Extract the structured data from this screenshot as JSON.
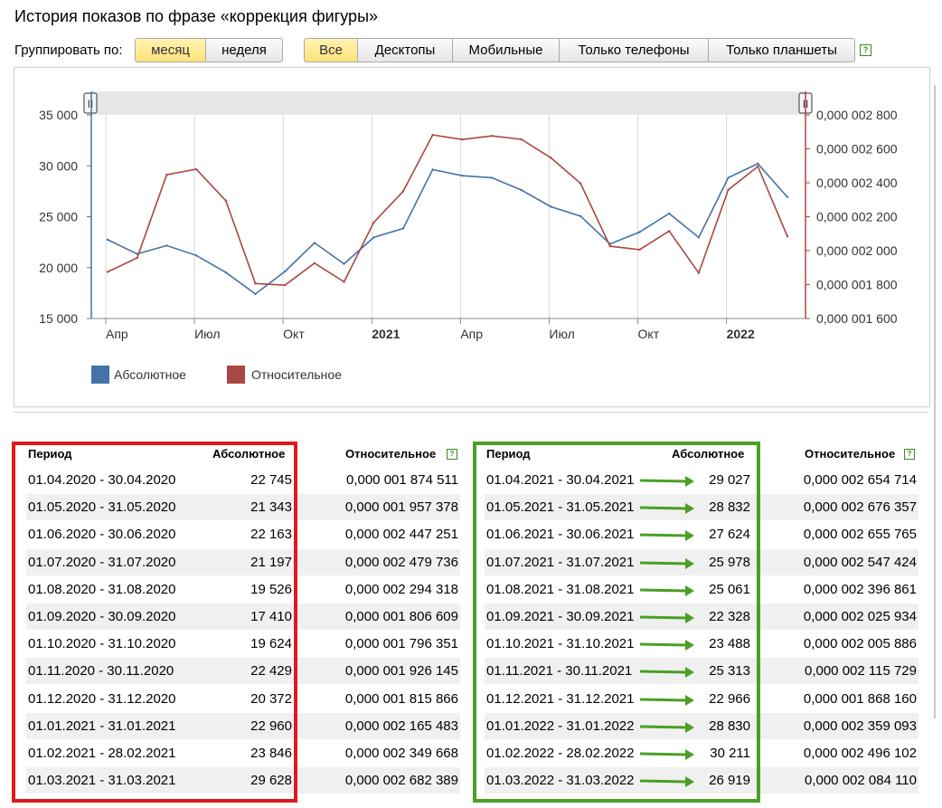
{
  "title": "История показов по фразе «коррекция фигуры»",
  "group_by": {
    "label": "Группировать по:",
    "options": [
      "месяц",
      "неделя"
    ],
    "active": "месяц"
  },
  "device_tabs": {
    "options": [
      "Все",
      "Десктопы",
      "Мобильные",
      "Только телефоны",
      "Только планшеты"
    ],
    "active": "Все"
  },
  "help_label": "?",
  "chart_data": {
    "type": "line",
    "x": [
      "2020-04",
      "2020-05",
      "2020-06",
      "2020-07",
      "2020-08",
      "2020-09",
      "2020-10",
      "2020-11",
      "2020-12",
      "2021-01",
      "2021-02",
      "2021-03",
      "2021-04",
      "2021-05",
      "2021-06",
      "2021-07",
      "2021-08",
      "2021-09",
      "2021-10",
      "2021-11",
      "2021-12",
      "2022-01",
      "2022-02",
      "2022-03"
    ],
    "x_tick_labels": [
      "Апр",
      "Июл",
      "Окт",
      "2021",
      "Апр",
      "Июл",
      "Окт",
      "2022"
    ],
    "x_tick_positions": [
      "2020-04",
      "2020-07",
      "2020-10",
      "2021-01",
      "2021-04",
      "2021-07",
      "2021-10",
      "2022-01"
    ],
    "bold_ticks": [
      "2021",
      "2022"
    ],
    "series": [
      {
        "name": "Абсолютное",
        "axis": "left",
        "color": "#4572a7",
        "values": [
          22745,
          21343,
          22163,
          21197,
          19526,
          17410,
          19624,
          22429,
          20372,
          22960,
          23846,
          29628,
          29027,
          28832,
          27624,
          25978,
          25061,
          22328,
          23488,
          25313,
          22966,
          28830,
          30211,
          26919
        ]
      },
      {
        "name": "Относительное",
        "axis": "right",
        "color": "#aa4643",
        "values": [
          1.874511e-06,
          1.957378e-06,
          2.447251e-06,
          2.479736e-06,
          2.294318e-06,
          1.806609e-06,
          1.796351e-06,
          1.926145e-06,
          1.815866e-06,
          2.165483e-06,
          2.349668e-06,
          2.682389e-06,
          2.654714e-06,
          2.676357e-06,
          2.655765e-06,
          2.547424e-06,
          2.396861e-06,
          2.025934e-06,
          2.005886e-06,
          2.115729e-06,
          1.86816e-06,
          2.359093e-06,
          2.496102e-06,
          2.08411e-06
        ]
      }
    ],
    "y_left": {
      "ylim": [
        15000,
        35000
      ],
      "tick_labels": [
        "35 000",
        "30 000",
        "25 000",
        "20 000",
        "15 000"
      ]
    },
    "y_right": {
      "ylim": [
        1.6e-06,
        2.8e-06
      ],
      "tick_labels": [
        "0,000 002 800",
        "0,000 002 600",
        "0,000 002 400",
        "0,000 002 200",
        "0,000 002 000",
        "0,000 001 800",
        "0,000 001 600"
      ]
    },
    "legend": [
      {
        "label": "Абсолютное",
        "color": "#4572a7"
      },
      {
        "label": "Относительное",
        "color": "#aa4643"
      }
    ],
    "navigator_handle_label": "II"
  },
  "table_left": {
    "headers": {
      "period": "Период",
      "abs": "Абсолютное",
      "rel": "Относительное"
    },
    "rows": [
      [
        "01.04.2020 - 30.04.2020",
        "22 745",
        "0,000 001 874 511"
      ],
      [
        "01.05.2020 - 31.05.2020",
        "21 343",
        "0,000 001 957 378"
      ],
      [
        "01.06.2020 - 30.06.2020",
        "22 163",
        "0,000 002 447 251"
      ],
      [
        "01.07.2020 - 31.07.2020",
        "21 197",
        "0,000 002 479 736"
      ],
      [
        "01.08.2020 - 31.08.2020",
        "19 526",
        "0,000 002 294 318"
      ],
      [
        "01.09.2020 - 30.09.2020",
        "17 410",
        "0,000 001 806 609"
      ],
      [
        "01.10.2020 - 31.10.2020",
        "19 624",
        "0,000 001 796 351"
      ],
      [
        "01.11.2020 - 30.11.2020",
        "22 429",
        "0,000 001 926 145"
      ],
      [
        "01.12.2020 - 31.12.2020",
        "20 372",
        "0,000 001 815 866"
      ],
      [
        "01.01.2021 - 31.01.2021",
        "22 960",
        "0,000 002 165 483"
      ],
      [
        "01.02.2021 - 28.02.2021",
        "23 846",
        "0,000 002 349 668"
      ],
      [
        "01.03.2021 - 31.03.2021",
        "29 628",
        "0,000 002 682 389"
      ]
    ]
  },
  "table_right": {
    "headers": {
      "period": "Период",
      "abs": "Абсолютное",
      "rel": "Относительное"
    },
    "rows": [
      [
        "01.04.2021 - 30.04.2021",
        "29 027",
        "0,000 002 654 714"
      ],
      [
        "01.05.2021 - 31.05.2021",
        "28 832",
        "0,000 002 676 357"
      ],
      [
        "01.06.2021 - 30.06.2021",
        "27 624",
        "0,000 002 655 765"
      ],
      [
        "01.07.2021 - 31.07.2021",
        "25 978",
        "0,000 002 547 424"
      ],
      [
        "01.08.2021 - 31.08.2021",
        "25 061",
        "0,000 002 396 861"
      ],
      [
        "01.09.2021 - 30.09.2021",
        "22 328",
        "0,000 002 025 934"
      ],
      [
        "01.10.2021 - 31.10.2021",
        "23 488",
        "0,000 002 005 886"
      ],
      [
        "01.11.2021 - 30.11.2021",
        "25 313",
        "0,000 002 115 729"
      ],
      [
        "01.12.2021 - 31.12.2021",
        "22 966",
        "0,000 001 868 160"
      ],
      [
        "01.01.2022 - 31.01.2022",
        "28 830",
        "0,000 002 359 093"
      ],
      [
        "01.02.2022 - 28.02.2022",
        "30 211",
        "0,000 002 496 102"
      ],
      [
        "01.03.2022 - 31.03.2022",
        "26 919",
        "0,000 002 084 110"
      ]
    ]
  },
  "colors": {
    "left_frame": "#e0191d",
    "right_frame": "#4aa023",
    "arrow": "#4aa023",
    "row_alt": "#f0f0f0",
    "active_button": "#ffe27a"
  }
}
